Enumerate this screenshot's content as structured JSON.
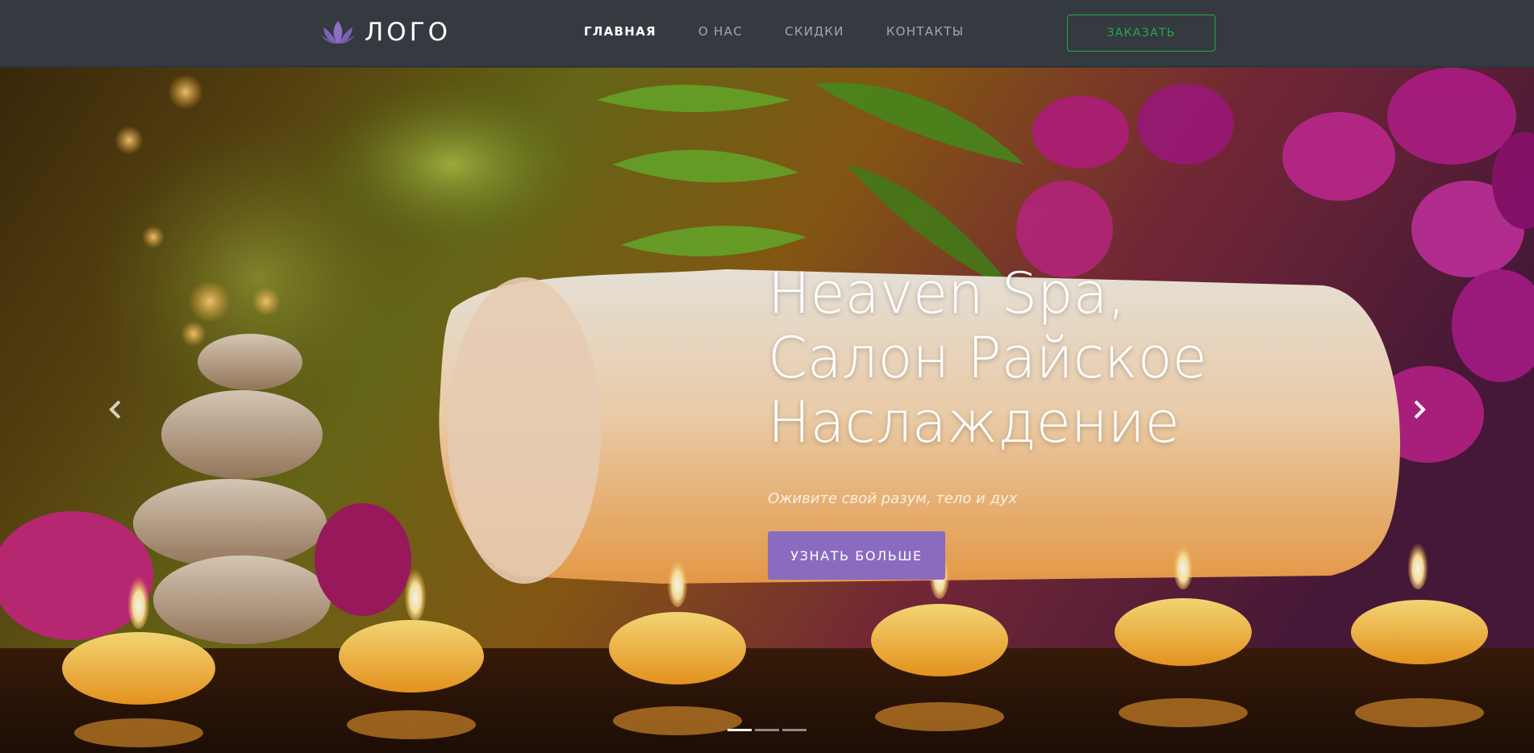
{
  "header": {
    "logo_text": "ЛОГО",
    "logo_icon": "lotus-icon",
    "nav": [
      {
        "label": "ГЛАВНАЯ",
        "active": true
      },
      {
        "label": "О НАС",
        "active": false
      },
      {
        "label": "СКИДКИ",
        "active": false
      },
      {
        "label": "КОНТАКТЫ",
        "active": false
      }
    ],
    "order_label": "ЗАКАЗАТЬ"
  },
  "hero": {
    "title_lines": [
      "Heaven Spa,",
      "Салон Райское",
      "Наслаждение"
    ],
    "subtitle": "Оживите свой разум, тело и дух",
    "button_label": "УЗНАТЬ БОЛЬШЕ",
    "prev_icon": "chevron-left-icon",
    "next_icon": "chevron-right-icon",
    "slide_count": 3,
    "active_slide": 1
  },
  "colors": {
    "navbar_bg": "#343a40",
    "accent_green": "#28a745",
    "accent_purple": "#8a6bbf",
    "logo_purple": "#8e6fc2"
  }
}
